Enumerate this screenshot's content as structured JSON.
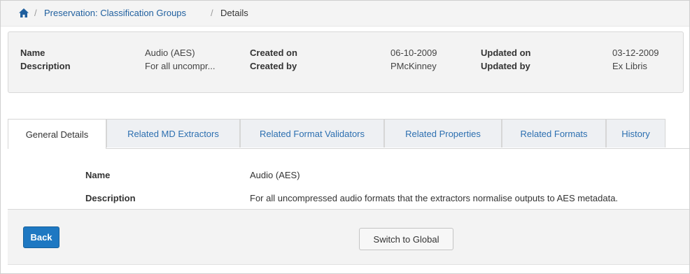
{
  "breadcrumb": {
    "home_icon": "home-icon",
    "separator": "/",
    "items": [
      "Preservation: Classification Groups",
      "Details"
    ]
  },
  "summary": {
    "name_label": "Name",
    "name_value": "Audio (AES)",
    "description_label": "Description",
    "description_value": "For all uncompr...",
    "created_on_label": "Created on",
    "created_on_value": "06-10-2009",
    "created_by_label": "Created by",
    "created_by_value": "PMcKinney",
    "updated_on_label": "Updated on",
    "updated_on_value": "03-12-2009",
    "updated_by_label": "Updated by",
    "updated_by_value": "Ex Libris"
  },
  "tabs": [
    {
      "label": "General Details",
      "active": true
    },
    {
      "label": "Related MD Extractors",
      "active": false
    },
    {
      "label": "Related Format Validators",
      "active": false
    },
    {
      "label": "Related Properties",
      "active": false
    },
    {
      "label": "Related Formats",
      "active": false
    },
    {
      "label": "History",
      "active": false
    }
  ],
  "details": {
    "name_label": "Name",
    "name_value": "Audio (AES)",
    "description_label": "Description",
    "description_value": "For all uncompressed audio formats that the extractors normalise outputs to AES metadata."
  },
  "actions": {
    "back_label": "Back",
    "switch_label": "Switch to Global"
  },
  "colors": {
    "link": "#1f5f9e",
    "primary_button": "#1e78c2",
    "panel_bg": "#f3f3f3"
  }
}
